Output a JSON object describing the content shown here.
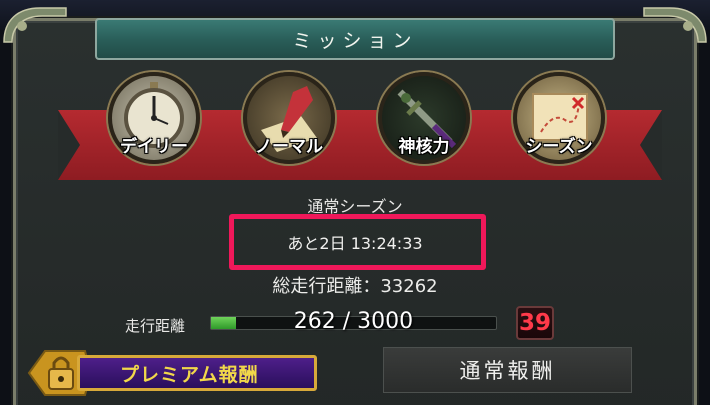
{
  "header": {
    "title": "ミッション"
  },
  "tabs": [
    {
      "label": "デイリー",
      "icon": "stopwatch-icon"
    },
    {
      "label": "ノーマル",
      "icon": "pencil-note-icon"
    },
    {
      "label": "神核力",
      "icon": "sword-icon"
    },
    {
      "label": "シーズン",
      "icon": "treasure-map-icon"
    }
  ],
  "season": {
    "name": "通常シーズン",
    "remaining": "あと2日 13:24:33",
    "total_distance": "総走行距離：33262"
  },
  "progress": {
    "label": "走行距離",
    "text": "262 / 3000",
    "current": 262,
    "max": 3000,
    "level": "39"
  },
  "reward_tabs": {
    "premium": "プレミアム報酬",
    "normal": "通常報酬"
  },
  "colors": {
    "highlight": "#f0185a",
    "ribbon": "#b52a30",
    "banner": "#2a5f5a",
    "progress": "#4fbf3f",
    "premium": "#4e1f8a",
    "level": "#ff3a4a"
  }
}
